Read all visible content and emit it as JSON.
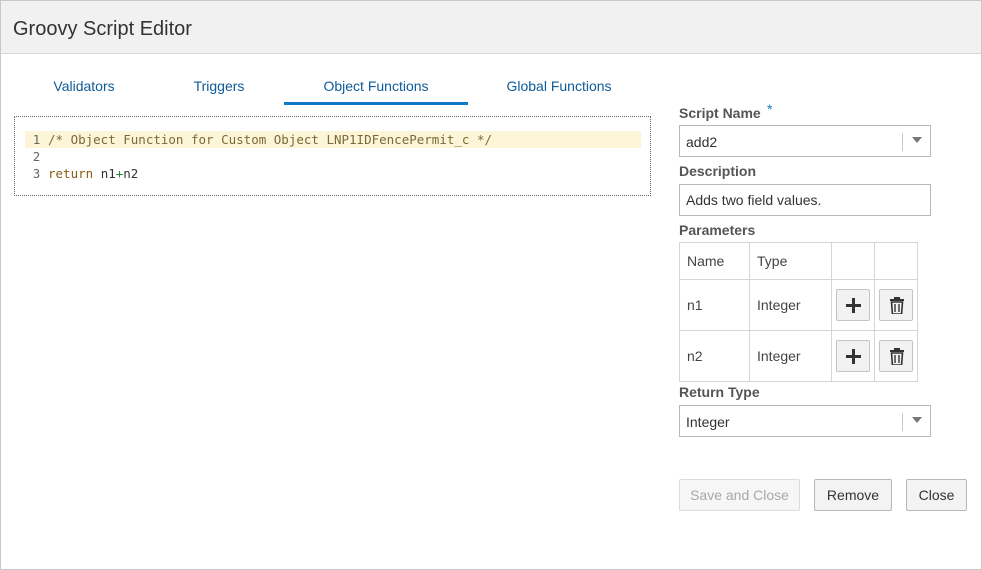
{
  "dialog": {
    "title": "Groovy Script Editor"
  },
  "tabs": [
    {
      "label": "Validators",
      "active": false
    },
    {
      "label": "Triggers",
      "active": false
    },
    {
      "label": "Object Functions",
      "active": true
    },
    {
      "label": "Global Functions",
      "active": false
    }
  ],
  "editor": {
    "lines": [
      {
        "number": "1",
        "text": "/* Object Function for Custom Object LNP1IDFencePermit_c */",
        "highlighted": true
      },
      {
        "number": "2",
        "text": "",
        "highlighted": false
      },
      {
        "number": "3",
        "keyword": "return",
        "id1": "n1",
        "op": "+",
        "id2": "n2",
        "highlighted": false
      }
    ]
  },
  "form": {
    "script_name": {
      "label": "Script Name",
      "required_marker": "*",
      "value": "add2"
    },
    "description": {
      "label": "Description",
      "value": "Adds two field values."
    },
    "parameters": {
      "label": "Parameters",
      "columns": [
        "Name",
        "Type"
      ],
      "rows": [
        {
          "name": "n1",
          "type": "Integer"
        },
        {
          "name": "n2",
          "type": "Integer"
        }
      ]
    },
    "return_type": {
      "label": "Return Type",
      "value": "Integer"
    }
  },
  "buttons": {
    "save_close": "Save and Close",
    "remove": "Remove",
    "close": "Close"
  },
  "colors": {
    "accent": "#0d7ac6",
    "tab_text": "#0d5b9a",
    "line_highlight": "#fdf5d8"
  }
}
